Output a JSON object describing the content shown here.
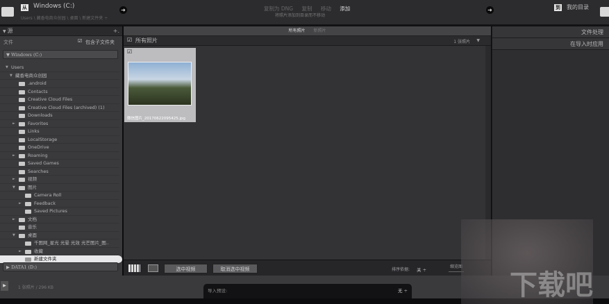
{
  "top": {
    "source_drive": "Windows (C:)",
    "source_path": "Users \\ 藏香电商众创园 \\ 桌面 \\ 新建文件夹 ÷",
    "modes": [
      "复制为 DNG",
      "复制",
      "移动",
      "添加"
    ],
    "active_mode": "添加",
    "mode_desc": "将照片添加到目录而不移动",
    "dest_label": "我的目录"
  },
  "left": {
    "title": "源",
    "files_label": "文件",
    "include_sub": "包含子文件夹",
    "drive_c": "Windows (C:)",
    "drive_d": "DATA1 (D:)",
    "tree": [
      {
        "label": "Users",
        "lvl": 0,
        "tri": "▼",
        "folder": false
      },
      {
        "label": "藏香电商众创园",
        "lvl": 1,
        "tri": "▼",
        "folder": false
      },
      {
        "label": ".android",
        "lvl": 2
      },
      {
        "label": "Contacts",
        "lvl": 2
      },
      {
        "label": "Creative Cloud Files",
        "lvl": 2
      },
      {
        "label": "Creative Cloud Files (archived) (1)",
        "lvl": 2
      },
      {
        "label": "Downloads",
        "lvl": 2
      },
      {
        "label": "Favorites",
        "lvl": 2,
        "tri": "►"
      },
      {
        "label": "Links",
        "lvl": 2
      },
      {
        "label": "LocalStorage",
        "lvl": 2
      },
      {
        "label": "OneDrive",
        "lvl": 2
      },
      {
        "label": "Roaming",
        "lvl": 2,
        "tri": "►"
      },
      {
        "label": "Saved Games",
        "lvl": 2
      },
      {
        "label": "Searches",
        "lvl": 2
      },
      {
        "label": "视频",
        "lvl": 2,
        "tri": "►"
      },
      {
        "label": "图片",
        "lvl": 2,
        "tri": "▼"
      },
      {
        "label": "Camera Roll",
        "lvl": 3
      },
      {
        "label": "Feedback",
        "lvl": 3,
        "tri": "►"
      },
      {
        "label": "Saved Pictures",
        "lvl": 3
      },
      {
        "label": "文档",
        "lvl": 2,
        "tri": "►"
      },
      {
        "label": "音乐",
        "lvl": 2
      },
      {
        "label": "桌面",
        "lvl": 2,
        "tri": "▼"
      },
      {
        "label": "千图网_星光 光晕 光效 光芒图片_图..",
        "lvl": 3
      },
      {
        "label": "收藏",
        "lvl": 3,
        "tri": "►"
      },
      {
        "label": "新建文件夹",
        "lvl": 3,
        "sel": true
      }
    ]
  },
  "center": {
    "tabs": [
      "所有照片",
      "新照片"
    ],
    "grid_title": "所有照片",
    "count": "1 张照片",
    "photo_name": "微信图片_20170622095425.jpg",
    "select_video": "选中视频",
    "deselect_video": "取消选中视频",
    "sort_label": "排序依据:",
    "sort_value": "关 ÷",
    "thumb_label": "缩览图"
  },
  "right": {
    "file_handling": "文件处理",
    "apply_on_import": "在导入时应用"
  },
  "bottom": {
    "status": "1 张照片 / 296 KB",
    "preset_label": "导入预设:",
    "preset_value": "无 ÷"
  },
  "watermark": "下载吧"
}
